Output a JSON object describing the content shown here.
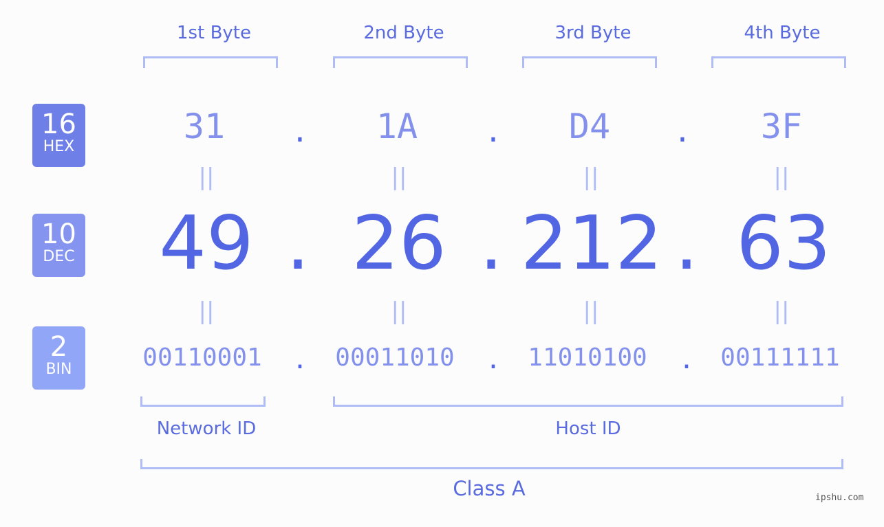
{
  "headers": [
    "1st Byte",
    "2nd Byte",
    "3rd Byte",
    "4th Byte"
  ],
  "badges": {
    "hex": {
      "num": "16",
      "label": "HEX",
      "color": "#6f7fe8"
    },
    "dec": {
      "num": "10",
      "label": "DEC",
      "color": "#8494ef"
    },
    "bin": {
      "num": "2",
      "label": "BIN",
      "color": "#91a6f6"
    }
  },
  "hex": [
    "31",
    "1A",
    "D4",
    "3F"
  ],
  "dec": [
    "49",
    "26",
    "212",
    "63"
  ],
  "bin": [
    "00110001",
    "00011010",
    "11010100",
    "00111111"
  ],
  "separator": ".",
  "equals": "=",
  "labels": {
    "network": "Network ID",
    "host": "Host ID",
    "class": "Class A"
  },
  "watermark": "ipshu.com"
}
